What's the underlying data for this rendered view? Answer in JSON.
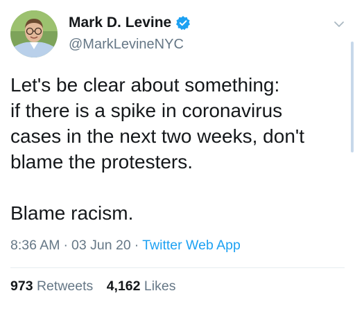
{
  "author": {
    "display_name": "Mark D. Levine",
    "handle": "@MarkLevineNYC",
    "verified": true
  },
  "tweet": {
    "text": "Let's be clear about something:\nif there is a spike in coronavirus\ncases in the next two weeks, don't\nblame the protesters.\n\nBlame racism.",
    "time": "8:36 AM",
    "date": "03 Jun 20",
    "source": "Twitter Web App",
    "separator": "·"
  },
  "stats": {
    "retweets_count": "973",
    "retweets_label": "Retweets",
    "likes_count": "4,162",
    "likes_label": "Likes"
  },
  "icons": {
    "verified": "verified-badge-icon",
    "caret": "chevron-down-icon"
  },
  "colors": {
    "accent": "#1da1f2",
    "muted": "#657786",
    "text": "#14171a"
  }
}
